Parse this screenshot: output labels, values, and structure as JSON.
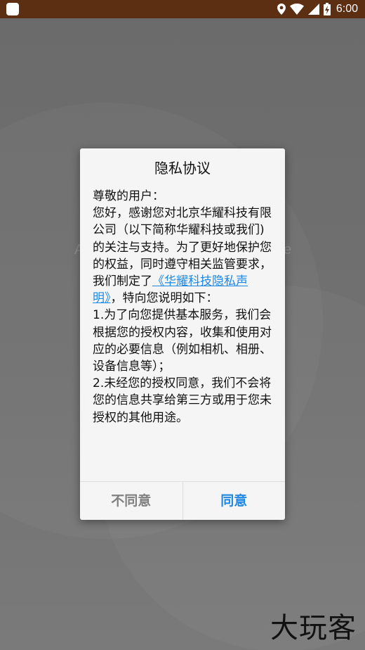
{
  "status_bar": {
    "time": "6:00",
    "icons": [
      "app-notification-icon",
      "location-icon",
      "wifi-icon",
      "signal-icon",
      "battery-charging-icon"
    ]
  },
  "background": {
    "partial_left_char": "A",
    "partial_right_char": "e",
    "watermark": "大玩客"
  },
  "dialog": {
    "title": "隐私协议",
    "greeting": "尊敬的用户：",
    "intro_before_link": "您好，感谢您对北京华耀科技有限公司（以下简称华耀科技或我们)的关注与支持。为了更好地保护您的权益，同时遵守相关监管要求，我们制定了",
    "link_text": "《华耀科技隐私声明》",
    "intro_after_link": "，特向您说明如下：",
    "item1": "1.为了向您提供基本服务，我们会根据您的授权内容，收集和使用对应的必要信息（例如相机、相册、设备信息等）；",
    "item2": "2.未经您的授权同意，我们不会将您的信息共享给第三方或用于您未授权的其他用途。",
    "disagree_label": "不同意",
    "agree_label": "同意"
  },
  "colors": {
    "status_bar": "#5c2e12",
    "accent": "#1e88e5",
    "disagree_text": "#808080",
    "dialog_bg": "#f5f5f5",
    "scrim": "#6e6e6e"
  }
}
